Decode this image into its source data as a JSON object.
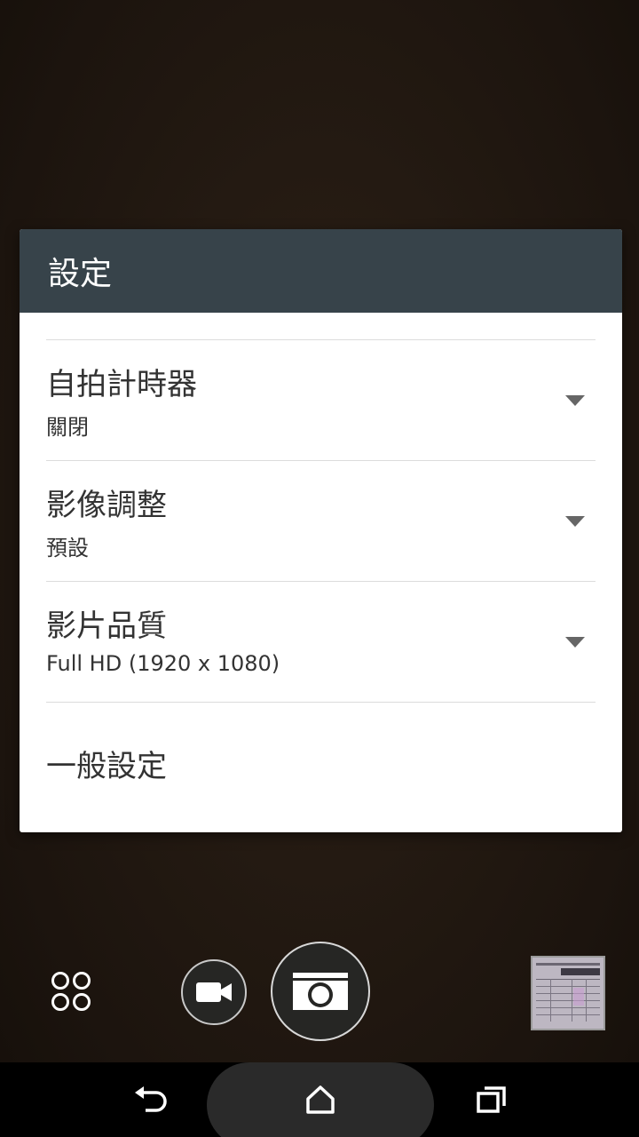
{
  "dialog": {
    "title": "設定",
    "items": [
      {
        "label": "自拍計時器",
        "value": "關閉"
      },
      {
        "label": "影像調整",
        "value": "預設"
      },
      {
        "label": "影片品質",
        "value": "Full HD (1920 x 1080)"
      },
      {
        "label": "一般設定"
      }
    ]
  },
  "camera_controls": {
    "icons": [
      "apps-icon",
      "video-camera-icon",
      "camera-shutter-icon",
      "gallery-thumbnail"
    ]
  },
  "nav_bar": {
    "icons": [
      "back-icon",
      "home-icon",
      "recent-apps-icon"
    ]
  },
  "colors": {
    "dialog_header": "#37434a",
    "background": "#241a12"
  }
}
